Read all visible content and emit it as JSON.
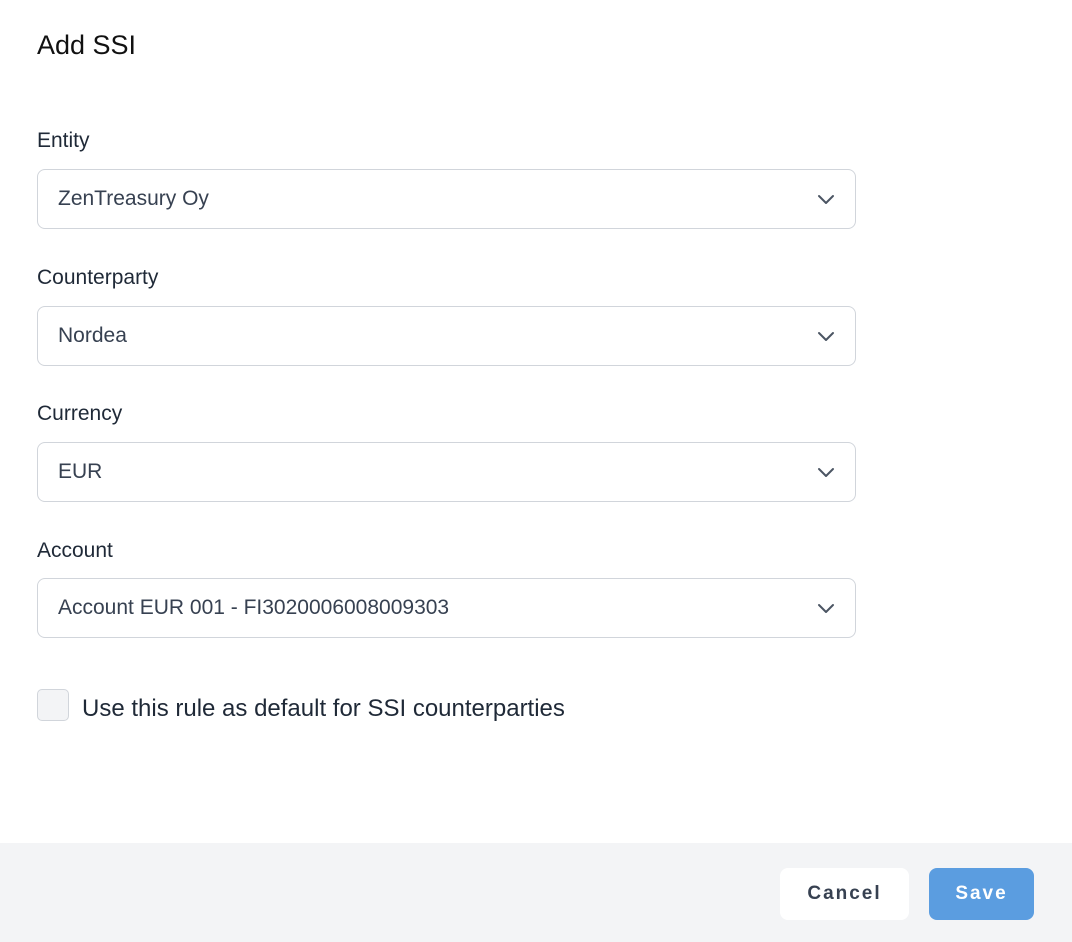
{
  "dialog": {
    "title": "Add SSI"
  },
  "fields": {
    "entity": {
      "label": "Entity",
      "value": "ZenTreasury Oy"
    },
    "counterparty": {
      "label": "Counterparty",
      "value": "Nordea"
    },
    "currency": {
      "label": "Currency",
      "value": "EUR"
    },
    "account": {
      "label": "Account",
      "value": "Account EUR 001 - FI3020006008009303"
    }
  },
  "default_rule": {
    "label": "Use this rule as default for SSI counterparties",
    "checked": false
  },
  "footer": {
    "cancel_label": "Cancel",
    "save_label": "Save"
  },
  "icons": {
    "select_chevron": "chevron-down-icon"
  },
  "colors": {
    "primary_button": "#5b9de0",
    "footer_background": "#f3f4f6",
    "border": "#d1d5db"
  }
}
